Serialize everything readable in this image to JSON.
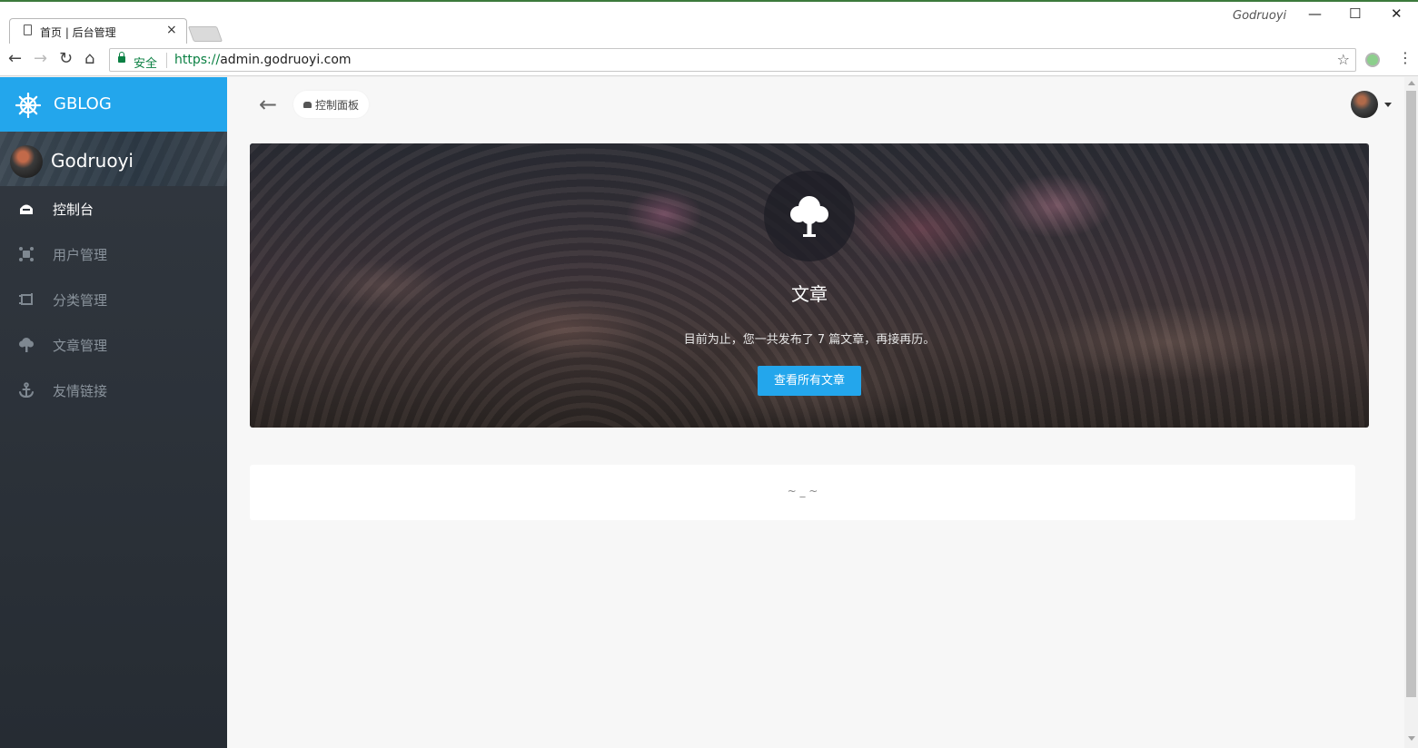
{
  "browser": {
    "tab_title": "首页 | 后台管理",
    "tab_close": "×",
    "window_user": "Godruoyi",
    "win_minimize": "—",
    "win_maximize": "☐",
    "win_close": "✕",
    "back": "←",
    "forward": "→",
    "reload": "↻",
    "home": "⌂",
    "secure_label": "安全",
    "url_scheme": "https://",
    "url_rest": "admin.godruoyi.com",
    "star": "☆",
    "menu": "⋮"
  },
  "sidebar": {
    "brand": "GBLOG",
    "profile_name": "Godruoyi",
    "items": [
      {
        "label": "控制台",
        "icon": "dashboard-icon",
        "active": true
      },
      {
        "label": "用户管理",
        "icon": "users-icon",
        "active": false
      },
      {
        "label": "分类管理",
        "icon": "category-icon",
        "active": false
      },
      {
        "label": "文章管理",
        "icon": "tree-icon",
        "active": false
      },
      {
        "label": "友情链接",
        "icon": "anchor-icon",
        "active": false
      }
    ]
  },
  "header": {
    "back_arrow": "←",
    "breadcrumb": "控制面板"
  },
  "hero": {
    "title": "文章",
    "description": "目前为止，您一共发布了 7 篇文章，再接再历。",
    "button": "查看所有文章"
  },
  "empty_card": {
    "text": "~ _ ~"
  },
  "colors": {
    "accent": "#23a6ec",
    "sidebar_bg": "#2b3138",
    "secure_green": "#0b8043"
  }
}
